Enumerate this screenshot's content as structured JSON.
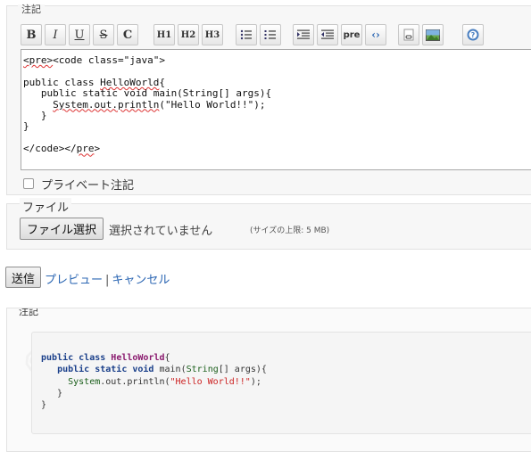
{
  "notes": {
    "legend": "注記",
    "toolbar": [
      {
        "label": "B",
        "icon": "bold-icon"
      },
      {
        "label": "I",
        "icon": "italic-icon"
      },
      {
        "label": "U",
        "icon": "underline-icon"
      },
      {
        "label": "S",
        "icon": "strikethrough-icon"
      },
      {
        "label": "C",
        "icon": "code-inline-icon"
      },
      {
        "label": "H1",
        "icon": "heading1-icon"
      },
      {
        "label": "H2",
        "icon": "heading2-icon"
      },
      {
        "label": "H3",
        "icon": "heading3-icon"
      },
      {
        "label": "",
        "icon": "bullet-list-icon"
      },
      {
        "label": "",
        "icon": "numbered-list-icon"
      },
      {
        "label": "",
        "icon": "indent-icon"
      },
      {
        "label": "",
        "icon": "outdent-icon"
      },
      {
        "label": "pre",
        "icon": "pre-icon"
      },
      {
        "label": "",
        "icon": "code-icon"
      },
      {
        "label": "",
        "icon": "link-icon"
      },
      {
        "label": "",
        "icon": "image-icon"
      },
      {
        "label": "",
        "icon": "help-icon"
      }
    ],
    "editor_lines": [
      "<pre><code class=\"java\">",
      "",
      "public class HelloWorld{",
      "   public static void main(String[] args){",
      "     System.out.println(\"Hello World!!\");",
      "   }",
      "}",
      "",
      "</code></pre>"
    ],
    "private_label": "プライベート注記"
  },
  "file": {
    "legend": "ファイル",
    "button_label": "ファイル選択",
    "status": "選択されていません",
    "limit": "(サイズの上限: 5 MB)"
  },
  "actions": {
    "send_label": "送信",
    "preview_label": "プレビュー",
    "separator": "|",
    "cancel_label": "キャンセル"
  },
  "preview": {
    "legend": "注記",
    "code_lines": [
      "public class HelloWorld{",
      "   public static void main(String[] args){",
      "     System.out.println(\"Hello World!!\");",
      "   }",
      "}"
    ]
  }
}
